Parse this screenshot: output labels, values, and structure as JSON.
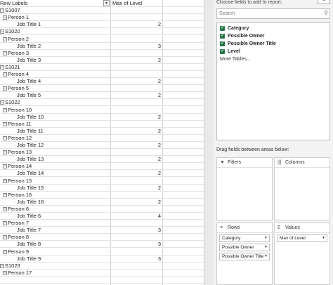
{
  "pivot": {
    "header": {
      "row_labels": "Row Labels",
      "max_of_level": "Max of Level",
      "filter_glyph": "▾"
    },
    "toggle_glyph": "⊟",
    "rows": [
      {
        "label": "S1007",
        "indent": 0,
        "toggle": true,
        "value": ""
      },
      {
        "label": "Person 1",
        "indent": 1,
        "toggle": true,
        "value": ""
      },
      {
        "label": "Job Title 1",
        "indent": 2,
        "toggle": false,
        "value": "2"
      },
      {
        "label": "S1020",
        "indent": 0,
        "toggle": true,
        "value": ""
      },
      {
        "label": "Person 2",
        "indent": 1,
        "toggle": true,
        "value": ""
      },
      {
        "label": "Job Title 2",
        "indent": 2,
        "toggle": false,
        "value": "3"
      },
      {
        "label": "Person 3",
        "indent": 1,
        "toggle": true,
        "value": ""
      },
      {
        "label": "Job Title 3",
        "indent": 2,
        "toggle": false,
        "value": "2"
      },
      {
        "label": "S1021",
        "indent": 0,
        "toggle": true,
        "value": ""
      },
      {
        "label": "Person 4",
        "indent": 1,
        "toggle": true,
        "value": ""
      },
      {
        "label": "Job Title 4",
        "indent": 2,
        "toggle": false,
        "value": "2"
      },
      {
        "label": "Person 5",
        "indent": 1,
        "toggle": true,
        "value": ""
      },
      {
        "label": "Job Title 5",
        "indent": 2,
        "toggle": false,
        "value": "2"
      },
      {
        "label": "S1022",
        "indent": 0,
        "toggle": true,
        "value": ""
      },
      {
        "label": "Person 10",
        "indent": 1,
        "toggle": true,
        "value": ""
      },
      {
        "label": "Job Title 10",
        "indent": 2,
        "toggle": false,
        "value": "2"
      },
      {
        "label": "Person 11",
        "indent": 1,
        "toggle": true,
        "value": ""
      },
      {
        "label": "Job Title 11",
        "indent": 2,
        "toggle": false,
        "value": "2"
      },
      {
        "label": "Person 12",
        "indent": 1,
        "toggle": true,
        "value": ""
      },
      {
        "label": "Job Title 12",
        "indent": 2,
        "toggle": false,
        "value": "2"
      },
      {
        "label": "Person 13",
        "indent": 1,
        "toggle": true,
        "value": ""
      },
      {
        "label": "Job Title 13",
        "indent": 2,
        "toggle": false,
        "value": "2"
      },
      {
        "label": "Person 14",
        "indent": 1,
        "toggle": true,
        "value": ""
      },
      {
        "label": "Job Title 14",
        "indent": 2,
        "toggle": false,
        "value": "2"
      },
      {
        "label": "Person 15",
        "indent": 1,
        "toggle": true,
        "value": ""
      },
      {
        "label": "Job Title 15",
        "indent": 2,
        "toggle": false,
        "value": "2"
      },
      {
        "label": "Person 16",
        "indent": 1,
        "toggle": true,
        "value": ""
      },
      {
        "label": "Job Title 16",
        "indent": 2,
        "toggle": false,
        "value": "2"
      },
      {
        "label": "Person 6",
        "indent": 1,
        "toggle": true,
        "value": ""
      },
      {
        "label": "Job Title 6",
        "indent": 2,
        "toggle": false,
        "value": "4"
      },
      {
        "label": "Person 7",
        "indent": 1,
        "toggle": true,
        "value": ""
      },
      {
        "label": "Job Title 7",
        "indent": 2,
        "toggle": false,
        "value": "3"
      },
      {
        "label": "Person 8",
        "indent": 1,
        "toggle": true,
        "value": ""
      },
      {
        "label": "Job Title 8",
        "indent": 2,
        "toggle": false,
        "value": "3"
      },
      {
        "label": "Person 9",
        "indent": 1,
        "toggle": true,
        "value": ""
      },
      {
        "label": "Job Title 9",
        "indent": 2,
        "toggle": false,
        "value": "3"
      },
      {
        "label": "S1023",
        "indent": 0,
        "toggle": true,
        "value": ""
      },
      {
        "label": "Person 17",
        "indent": 1,
        "toggle": true,
        "value": ""
      },
      {
        "label": "",
        "indent": 2,
        "toggle": false,
        "value": ""
      },
      {
        "label": "",
        "indent": 2,
        "toggle": false,
        "value": ""
      }
    ]
  },
  "field_list": {
    "title": "Choose fields to add to report:",
    "settings_icon": "gear-icon",
    "search_placeholder": "Search",
    "search_icon_glyph": "⚲",
    "check_glyph": "✓",
    "fields": [
      {
        "label": "Category",
        "checked": true
      },
      {
        "label": "Possible Owner",
        "checked": true
      },
      {
        "label": "Possible Owner Title",
        "checked": true
      },
      {
        "label": "Level",
        "checked": true
      }
    ],
    "more_tables": "More Tables...",
    "drag_label": "Drag fields between areas below:",
    "areas": {
      "filters": {
        "label": "Filters",
        "glyph": "▼"
      },
      "columns": {
        "label": "Columns",
        "glyph": "|||"
      },
      "rows": {
        "label": "Rows",
        "glyph": "≡",
        "items": [
          "Category",
          "Possible Owner",
          "Possible Owner Title"
        ]
      },
      "values": {
        "label": "Values",
        "glyph": "Σ",
        "items": [
          "Max of Level"
        ]
      }
    },
    "dropdown_glyph": "▼"
  }
}
